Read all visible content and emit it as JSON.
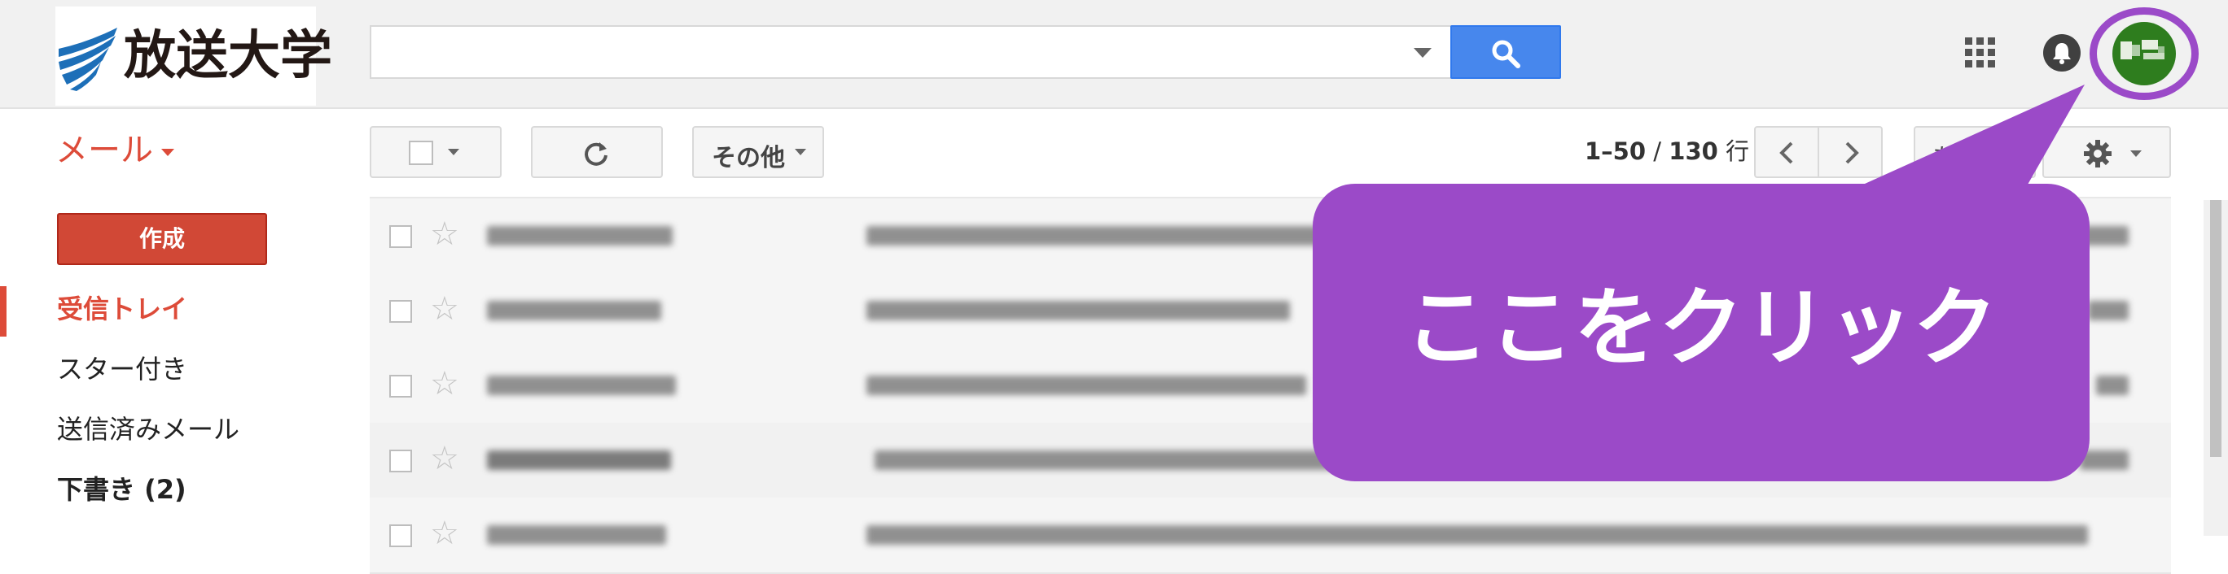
{
  "header": {
    "logo_text": "放送大学",
    "search": {
      "value": "",
      "placeholder": ""
    },
    "icons": [
      "apps-icon",
      "notifications-bell-icon",
      "search-icon",
      "account-avatar"
    ],
    "colors": {
      "search_button": "#4787ed",
      "header_bg": "#f1f1f1"
    }
  },
  "toolbar": {
    "app_title": "メール",
    "more_label": "その他",
    "count": {
      "start_end": "1–50",
      "separator": " / ",
      "total": "130",
      "unit": " 行"
    },
    "partial_label": "あ"
  },
  "sidebar": {
    "compose_label": "作成",
    "items": [
      {
        "label": "受信トレイ",
        "active": true
      },
      {
        "label": "スター付き",
        "active": false
      },
      {
        "label": "送信済みメール",
        "active": false
      },
      {
        "label": "下書き (2)",
        "active": false
      }
    ]
  },
  "message_list": {
    "visible_rows": 5,
    "content": "blurred"
  },
  "annotation": {
    "callout_text": "ここをクリック",
    "color": "#9b4ac8"
  },
  "colors": {
    "accent_red": "#dd4b39",
    "compose_red": "#d14836",
    "callout_purple": "#9b4ac8"
  }
}
